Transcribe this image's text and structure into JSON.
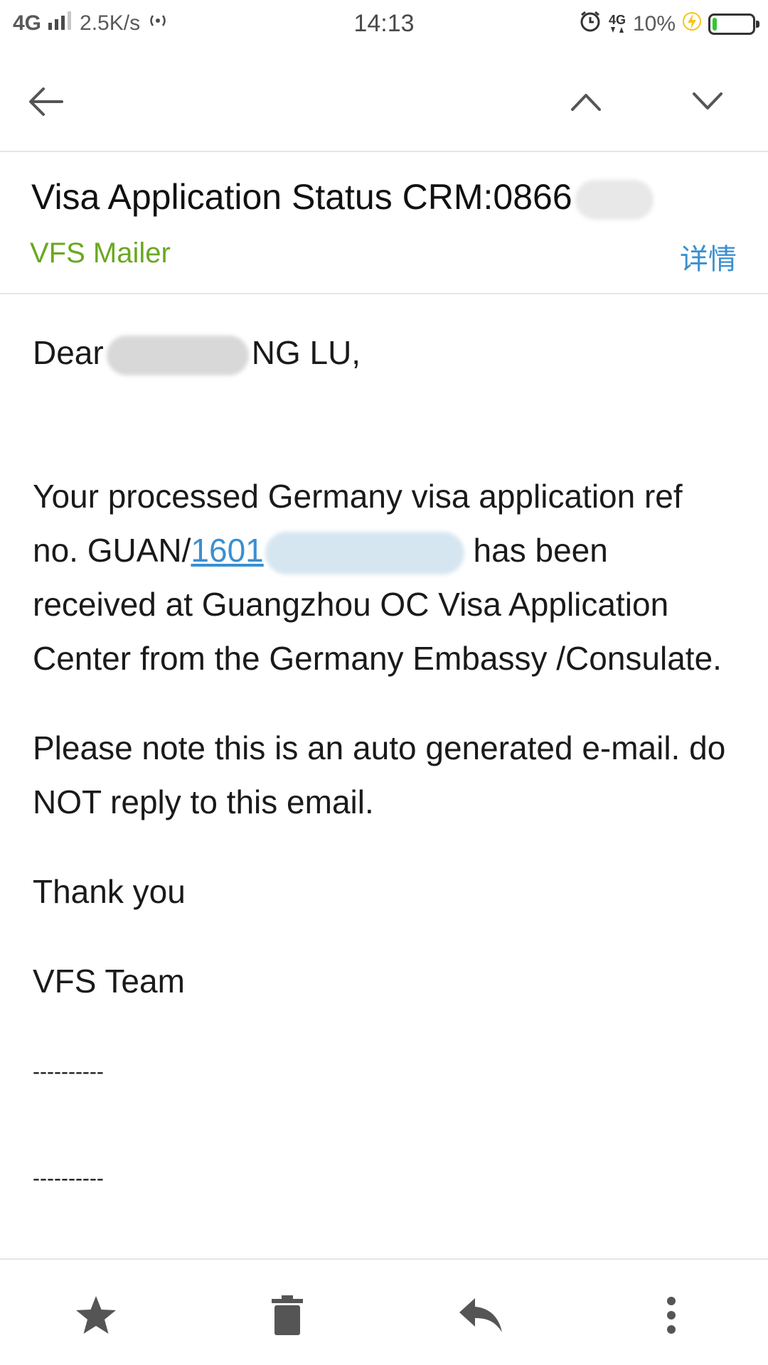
{
  "status_bar": {
    "network_type": "4G",
    "speed": "2.5K/s",
    "time": "14:13",
    "network_type_right": "4G",
    "battery_percent": "10%",
    "battery_level": 0.1,
    "icons": [
      "signal-icon",
      "hotspot-icon",
      "alarm-icon",
      "data-arrows-icon",
      "charging-icon",
      "battery-icon"
    ]
  },
  "toolbar": {
    "icons": [
      "back-arrow-icon",
      "chevron-up-icon",
      "chevron-down-icon"
    ]
  },
  "header": {
    "subject": "Visa Application Status CRM:0866",
    "sender": "VFS Mailer",
    "details_label": "详情"
  },
  "body": {
    "greeting_prefix": "Dear",
    "greeting_suffix": "NG LU,",
    "para1_before_link": "Your processed Germany visa application ref no. GUAN/",
    "ref_link_text": "1601",
    "para1_after_link": " has been received at Guangzhou OC Visa Application Center from the Germany Embassy /Consulate.",
    "para2": "Please note this is an auto generated e-mail.  do NOT reply to this email.",
    "thanks": "Thank you",
    "signature": "VFS Team",
    "divider1": "----------",
    "divider2": "----------"
  },
  "bottom_bar": {
    "icons": [
      "star-icon",
      "trash-icon",
      "reply-icon",
      "more-vertical-icon"
    ]
  },
  "colors": {
    "sender_green": "#6aa820",
    "link_blue": "#3a8fd0",
    "divider_gray": "#e6e6e6",
    "battery_green": "#32c832",
    "charging_yellow": "#f5c518"
  }
}
